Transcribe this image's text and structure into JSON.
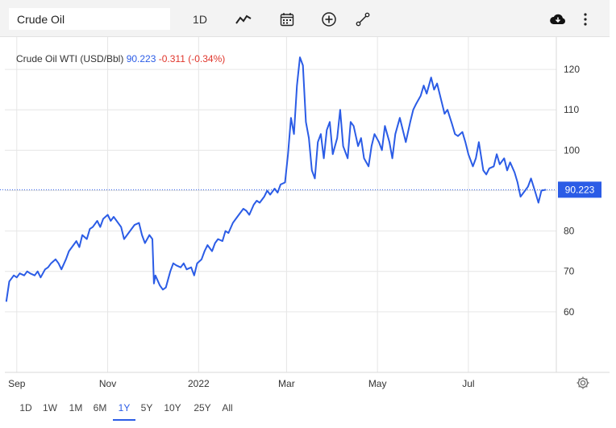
{
  "toolbar": {
    "symbol_value": "Crude Oil",
    "interval_label": "1D",
    "icons": [
      "line-chart-icon",
      "calendar-icon",
      "add-circle-icon",
      "draw-line-icon",
      "download-icon",
      "more-vertical-icon"
    ]
  },
  "legend": {
    "name": "Crude Oil WTI (USD/Bbl)",
    "price": "90.223",
    "change": "-0.311 (-0.34%)"
  },
  "price_label": "90.223",
  "ranges": [
    "1D",
    "1W",
    "1M",
    "6M",
    "1Y",
    "5Y",
    "10Y",
    "25Y",
    "All"
  ],
  "active_range": "1Y",
  "colors": {
    "line": "#2b5ce6",
    "negative": "#e0362c",
    "grid": "#e6e6e6",
    "price_label_bg": "#2b5ce6"
  },
  "chart_data": {
    "type": "line",
    "title": "",
    "xlabel": "",
    "ylabel": "",
    "ylim": [
      45,
      128
    ],
    "yticks": [
      60,
      70,
      80,
      90,
      100,
      110,
      120
    ],
    "xticks": [
      "Sep",
      "Nov",
      "2022",
      "Mar",
      "May",
      "Jul"
    ],
    "grid": true,
    "last_value": 90.223,
    "series": [
      {
        "name": "Crude Oil WTI (USD/Bbl)",
        "points": [
          [
            "2021-08-25",
            62.5
          ],
          [
            "2021-08-27",
            67.5
          ],
          [
            "2021-08-30",
            69
          ],
          [
            "2021-09-01",
            68.5
          ],
          [
            "2021-09-03",
            69.5
          ],
          [
            "2021-09-06",
            69
          ],
          [
            "2021-09-08",
            70
          ],
          [
            "2021-09-10",
            69.5
          ],
          [
            "2021-09-13",
            69
          ],
          [
            "2021-09-15",
            70
          ],
          [
            "2021-09-17",
            68.5
          ],
          [
            "2021-09-20",
            70.5
          ],
          [
            "2021-09-22",
            71
          ],
          [
            "2021-09-24",
            72
          ],
          [
            "2021-09-27",
            73
          ],
          [
            "2021-09-29",
            72
          ],
          [
            "2021-10-01",
            70.5
          ],
          [
            "2021-10-04",
            73
          ],
          [
            "2021-10-06",
            75
          ],
          [
            "2021-10-08",
            76
          ],
          [
            "2021-10-11",
            77.5
          ],
          [
            "2021-10-13",
            76
          ],
          [
            "2021-10-15",
            79
          ],
          [
            "2021-10-18",
            78
          ],
          [
            "2021-10-20",
            80.5
          ],
          [
            "2021-10-22",
            81
          ],
          [
            "2021-10-25",
            82.5
          ],
          [
            "2021-10-27",
            81
          ],
          [
            "2021-10-29",
            83
          ],
          [
            "2021-11-01",
            84
          ],
          [
            "2021-11-03",
            82.5
          ],
          [
            "2021-11-05",
            83.5
          ],
          [
            "2021-11-08",
            82
          ],
          [
            "2021-11-10",
            81
          ],
          [
            "2021-11-12",
            78
          ],
          [
            "2021-11-15",
            79.5
          ],
          [
            "2021-11-17",
            80.5
          ],
          [
            "2021-11-19",
            81.5
          ],
          [
            "2021-11-22",
            82
          ],
          [
            "2021-11-24",
            79
          ],
          [
            "2021-11-26",
            77
          ],
          [
            "2021-11-29",
            79
          ],
          [
            "2021-12-01",
            78
          ],
          [
            "2021-12-02",
            67
          ],
          [
            "2021-12-03",
            69
          ],
          [
            "2021-12-06",
            66.5
          ],
          [
            "2021-12-08",
            65.5
          ],
          [
            "2021-12-10",
            66
          ],
          [
            "2021-12-13",
            70
          ],
          [
            "2021-12-15",
            72
          ],
          [
            "2021-12-17",
            71.5
          ],
          [
            "2021-12-20",
            71
          ],
          [
            "2021-12-22",
            72
          ],
          [
            "2021-12-24",
            70.5
          ],
          [
            "2021-12-27",
            71
          ],
          [
            "2021-12-29",
            69
          ],
          [
            "2021-12-31",
            72
          ],
          [
            "2022-01-03",
            73
          ],
          [
            "2022-01-05",
            75
          ],
          [
            "2022-01-07",
            76.5
          ],
          [
            "2022-01-10",
            75
          ],
          [
            "2022-01-12",
            77
          ],
          [
            "2022-01-14",
            78
          ],
          [
            "2022-01-17",
            77.5
          ],
          [
            "2022-01-19",
            80
          ],
          [
            "2022-01-21",
            79.5
          ],
          [
            "2022-01-24",
            82
          ],
          [
            "2022-01-26",
            83
          ],
          [
            "2022-01-28",
            84
          ],
          [
            "2022-01-31",
            85.5
          ],
          [
            "2022-02-02",
            85
          ],
          [
            "2022-02-04",
            84
          ],
          [
            "2022-02-07",
            86.5
          ],
          [
            "2022-02-09",
            87.5
          ],
          [
            "2022-02-11",
            87
          ],
          [
            "2022-02-14",
            88.5
          ],
          [
            "2022-02-16",
            90
          ],
          [
            "2022-02-18",
            89
          ],
          [
            "2022-02-21",
            90.5
          ],
          [
            "2022-02-23",
            89.5
          ],
          [
            "2022-02-25",
            91.5
          ],
          [
            "2022-02-28",
            92
          ],
          [
            "2022-03-02",
            99
          ],
          [
            "2022-03-04",
            108
          ],
          [
            "2022-03-06",
            104
          ],
          [
            "2022-03-08",
            116
          ],
          [
            "2022-03-10",
            123
          ],
          [
            "2022-03-12",
            121
          ],
          [
            "2022-03-14",
            107
          ],
          [
            "2022-03-16",
            103
          ],
          [
            "2022-03-18",
            95
          ],
          [
            "2022-03-20",
            93
          ],
          [
            "2022-03-22",
            102
          ],
          [
            "2022-03-24",
            104
          ],
          [
            "2022-03-26",
            98
          ],
          [
            "2022-03-28",
            105
          ],
          [
            "2022-03-30",
            107
          ],
          [
            "2022-04-01",
            99
          ],
          [
            "2022-04-04",
            103
          ],
          [
            "2022-04-06",
            110
          ],
          [
            "2022-04-08",
            101
          ],
          [
            "2022-04-11",
            98
          ],
          [
            "2022-04-13",
            107
          ],
          [
            "2022-04-15",
            106
          ],
          [
            "2022-04-18",
            101
          ],
          [
            "2022-04-20",
            103
          ],
          [
            "2022-04-22",
            98
          ],
          [
            "2022-04-25",
            96
          ],
          [
            "2022-04-27",
            101
          ],
          [
            "2022-04-29",
            104
          ],
          [
            "2022-05-02",
            102
          ],
          [
            "2022-05-04",
            100
          ],
          [
            "2022-05-06",
            106
          ],
          [
            "2022-05-09",
            102
          ],
          [
            "2022-05-11",
            98
          ],
          [
            "2022-05-13",
            104
          ],
          [
            "2022-05-16",
            108
          ],
          [
            "2022-05-18",
            105
          ],
          [
            "2022-05-20",
            102
          ],
          [
            "2022-05-23",
            107
          ],
          [
            "2022-05-25",
            110
          ],
          [
            "2022-05-27",
            111.5
          ],
          [
            "2022-05-30",
            113.5
          ],
          [
            "2022-06-01",
            116
          ],
          [
            "2022-06-03",
            114
          ],
          [
            "2022-06-06",
            118
          ],
          [
            "2022-06-08",
            115
          ],
          [
            "2022-06-10",
            116.5
          ],
          [
            "2022-06-13",
            112
          ],
          [
            "2022-06-15",
            109
          ],
          [
            "2022-06-17",
            110
          ],
          [
            "2022-06-20",
            106.5
          ],
          [
            "2022-06-22",
            104
          ],
          [
            "2022-06-24",
            103.5
          ],
          [
            "2022-06-27",
            104.5
          ],
          [
            "2022-06-29",
            102
          ],
          [
            "2022-07-01",
            99
          ],
          [
            "2022-07-04",
            96
          ],
          [
            "2022-07-06",
            98
          ],
          [
            "2022-07-08",
            102
          ],
          [
            "2022-07-11",
            95
          ],
          [
            "2022-07-13",
            94
          ],
          [
            "2022-07-15",
            95.5
          ],
          [
            "2022-07-18",
            96
          ],
          [
            "2022-07-20",
            99
          ],
          [
            "2022-07-22",
            96.5
          ],
          [
            "2022-07-25",
            98
          ],
          [
            "2022-07-27",
            95
          ],
          [
            "2022-07-29",
            97
          ],
          [
            "2022-08-01",
            94.5
          ],
          [
            "2022-08-03",
            92
          ],
          [
            "2022-08-05",
            88.5
          ],
          [
            "2022-08-08",
            90
          ],
          [
            "2022-08-10",
            91
          ],
          [
            "2022-08-12",
            93
          ],
          [
            "2022-08-15",
            89.5
          ],
          [
            "2022-08-17",
            87
          ],
          [
            "2022-08-19",
            90
          ],
          [
            "2022-08-22",
            90.223
          ]
        ]
      }
    ]
  }
}
